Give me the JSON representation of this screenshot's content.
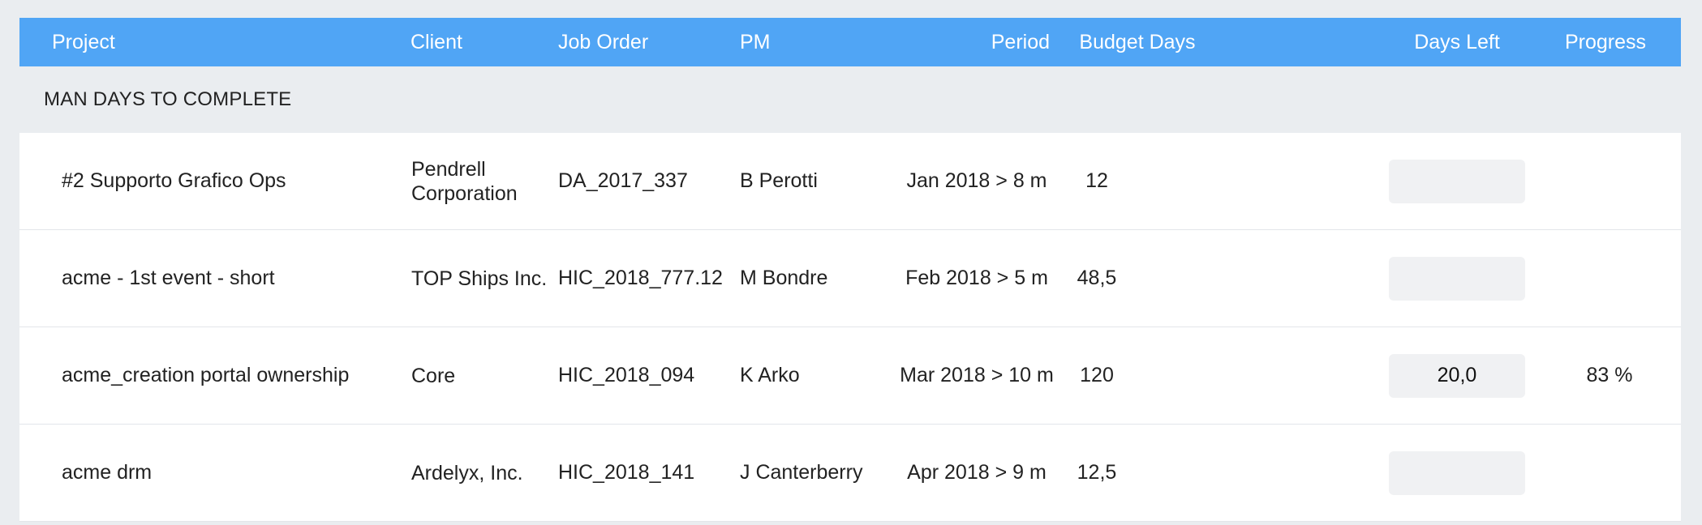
{
  "columns": {
    "project": "Project",
    "client": "Client",
    "job_order": "Job Order",
    "pm": "PM",
    "period": "Period",
    "budget_days": "Budget Days",
    "days_left": "Days Left",
    "progress": "Progress"
  },
  "section_title": "MAN DAYS TO COMPLETE",
  "rows": [
    {
      "project": "#2 Supporto Grafico Ops",
      "client": "Pendrell Corporation",
      "job_order": "DA_2017_337",
      "pm": "B Perotti",
      "period": "Jan 2018 > 8 m",
      "budget_days": "12",
      "days_left": "",
      "progress": ""
    },
    {
      "project": "acme - 1st event - short",
      "client": "TOP Ships Inc.",
      "job_order": "HIC_2018_777.12",
      "pm": "M Bondre",
      "period": "Feb 2018 > 5 m",
      "budget_days": "48,5",
      "days_left": "",
      "progress": ""
    },
    {
      "project": "acme_creation portal ownership",
      "client": "Core",
      "job_order": "HIC_2018_094",
      "pm": "K Arko",
      "period": "Mar 2018 > 10 m",
      "budget_days": "120",
      "days_left": "20,0",
      "progress": "83 %"
    },
    {
      "project": "acme drm",
      "client": "Ardelyx, Inc.",
      "job_order": "HIC_2018_141",
      "pm": "J Canterberry",
      "period": "Apr 2018 > 9 m",
      "budget_days": "12,5",
      "days_left": "",
      "progress": ""
    }
  ]
}
